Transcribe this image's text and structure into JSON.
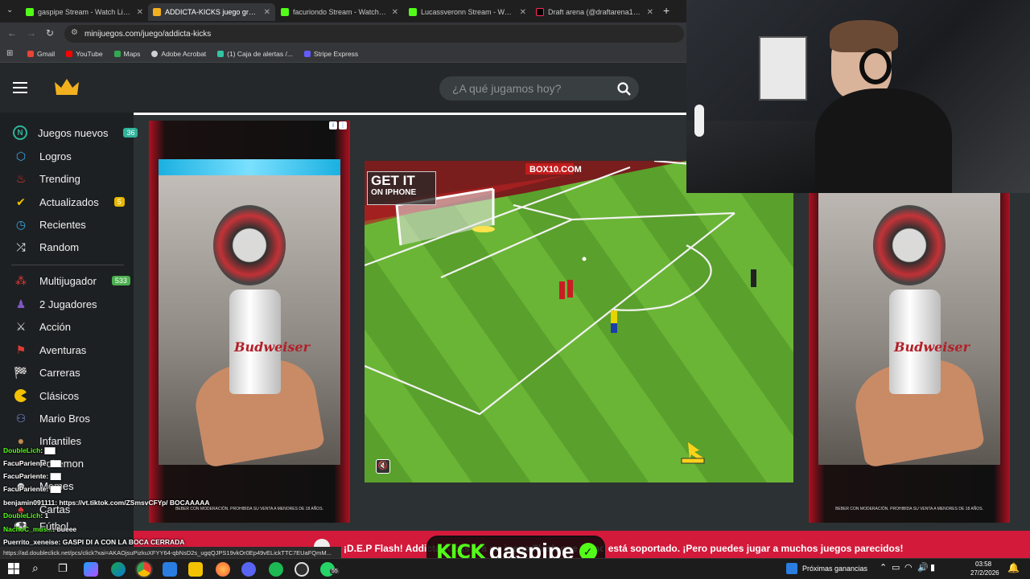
{
  "tabs": [
    {
      "title": "gaspipe Stream - Watch Live o",
      "favicon": "kick",
      "active": false
    },
    {
      "title": "ADDICTA-KICKS juego gratis on",
      "favicon": "crown",
      "active": true
    },
    {
      "title": "facuriondo Stream - Watch Live",
      "favicon": "kick",
      "active": false
    },
    {
      "title": "Lucassveronn Stream - Watch L",
      "favicon": "kick",
      "active": false
    },
    {
      "title": "Draft arena (@draftarena13) | T",
      "favicon": "tiktok",
      "active": false
    }
  ],
  "address": {
    "url": "minijuegos.com/juego/addicta-kicks"
  },
  "bookmarks": [
    {
      "label": "Gmail",
      "color": "#ea4335"
    },
    {
      "label": "YouTube",
      "color": "#ff0000"
    },
    {
      "label": "Maps",
      "color": "#34a853"
    },
    {
      "label": "Adobe Acrobat",
      "color": "#cfcfcf"
    },
    {
      "label": "(1) Caja de alertas /...",
      "color": "#32c3a2"
    },
    {
      "label": "Stripe Express",
      "color": "#635bff"
    }
  ],
  "site": {
    "search_placeholder": "¿A qué jugamos hoy?",
    "nav": [
      {
        "label": "Juegos nuevos",
        "icon": "new-icon",
        "badge": "36",
        "badge_color": "#2fb39b"
      },
      {
        "label": "Logros",
        "icon": "trophy-icon"
      },
      {
        "label": "Trending",
        "icon": "fire-icon"
      },
      {
        "label": "Actualizados",
        "icon": "check-icon",
        "badge": "5",
        "badge_color": "#e6b800"
      },
      {
        "label": "Recientes",
        "icon": "clock-icon"
      },
      {
        "label": "Random",
        "icon": "shuffle-icon"
      },
      {
        "label": "Multijugador",
        "icon": "multiplayer-icon",
        "badge": "533",
        "badge_color": "#4caf50"
      },
      {
        "label": "2 Jugadores",
        "icon": "two-players-icon"
      },
      {
        "label": "Acción",
        "icon": "swords-icon"
      },
      {
        "label": "Aventuras",
        "icon": "flag-icon"
      },
      {
        "label": "Carreras",
        "icon": "racing-flag-icon"
      },
      {
        "label": "Clásicos",
        "icon": "pacman-icon"
      },
      {
        "label": "Mario Bros",
        "icon": "mario-icon"
      },
      {
        "label": "Infantiles",
        "icon": "teddy-icon"
      },
      {
        "label": "Pokemon",
        "icon": "pokeball-icon"
      },
      {
        "label": "Memes",
        "icon": "meme-icon"
      },
      {
        "label": "Cartas",
        "icon": "cards-icon"
      },
      {
        "label": "Fútbol",
        "icon": "football-icon"
      }
    ],
    "ticker": "¡D.E.P Flash! Addicta-Kicks era un juego Flash que ya no está soportado. ¡Pero puedes jugar a muchos juegos parecidos!",
    "ad_brand": "Budweiser",
    "ad_foot": "BEBER CON MODERACIÓN. PROHIBIDA SU VENTA A MENORES DE 18 AÑOS."
  },
  "game": {
    "banner_line1": "GET IT",
    "banner_line2": "ON IPHONE",
    "sponsor": "BOX10.COM"
  },
  "stream": {
    "channel": "gaspipe",
    "brand": "KICK"
  },
  "chat": [
    {
      "user": "DoubleLich",
      "msg": ": ▇▇"
    },
    {
      "user": "FacuPariente",
      "msg": ": ▇▇"
    },
    {
      "user": "FacuPariente",
      "msg": ": ▇▇"
    },
    {
      "user": "FacuPariente",
      "msg": ": ▇▇"
    },
    {
      "user": "benjamin091111",
      "msg": ": https://vt.tiktok.com/ZSmsvCFYp/ BOCAAAAA"
    },
    {
      "user": "DoubleLich",
      "msg": ": 1"
    },
    {
      "user": "NachoC_mus...",
      "msg": ": bueee"
    },
    {
      "user": "Puerrito_xeneise",
      "msg": ": GASPI DI A CON LA BOCA CERRADA"
    }
  ],
  "status_url": "https://ad.doubleclick.net/pcs/click?xai=AKAOjsuPizkuXFYY64-qbNsD2s_ugqQJPS19vkOr0Ep49vELickTTC7EUaFQmM...",
  "taskbar": {
    "weather": "Próximas ganancias",
    "time": "03:58",
    "date": "27/2/2026",
    "whatsapp_count": "55"
  }
}
